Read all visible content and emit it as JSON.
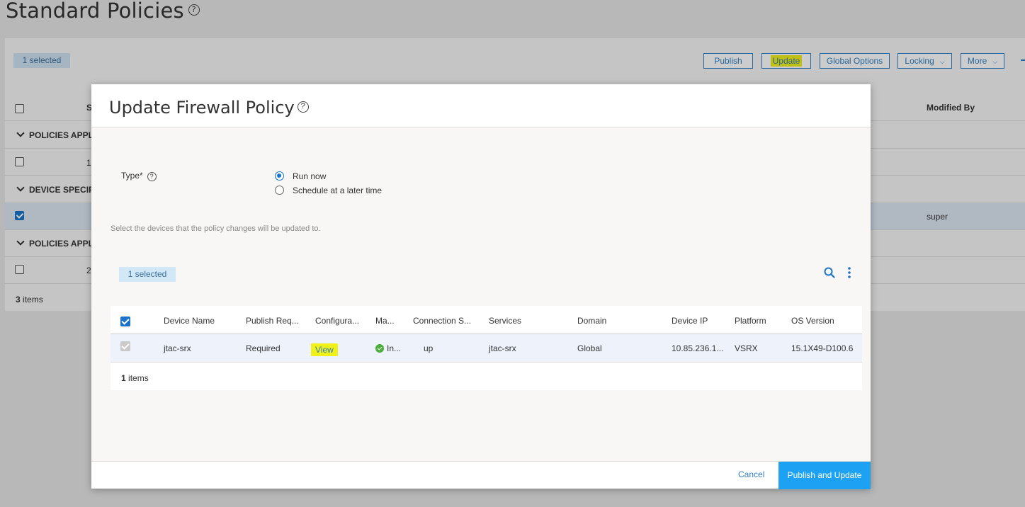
{
  "page": {
    "title": "Standard Policies",
    "help_glyph": "?"
  },
  "toolbar": {
    "selected_badge": "1 selected",
    "publish": "Publish",
    "update": "Update",
    "global_options": "Global Options",
    "locking": "Locking",
    "more": "More",
    "caret": "⌵"
  },
  "table": {
    "modified_by_header": "Modified By",
    "s_header_partial": "S",
    "groups": [
      {
        "label": "POLICIES APPLI"
      },
      {
        "label": "DEVICE SPECIFIC"
      },
      {
        "label": "POLICIES APPLI"
      }
    ],
    "rows": [
      {
        "seq_partial": "1",
        "modified_by": ""
      },
      {
        "seq_partial": "",
        "modified_by": "super"
      },
      {
        "seq_partial": "2",
        "modified_by": ""
      }
    ],
    "footer_count": "3",
    "footer_label": " items"
  },
  "modal": {
    "title": "Update Firewall Policy",
    "help_glyph": "?",
    "type_label": "Type*",
    "radio_options": [
      {
        "label": "Run now",
        "selected": true
      },
      {
        "label": "Schedule at a later time",
        "selected": false
      }
    ],
    "hint": "Select the devices that the policy changes will be updated to.",
    "selected_badge": "1 selected",
    "grid": {
      "headers": [
        "Device Name",
        "Publish Req...",
        "Configura...",
        "Ma...",
        "Connection S...",
        "Services",
        "Domain",
        "Device IP",
        "Platform",
        "OS Version"
      ],
      "row": {
        "device_name": "jtac-srx",
        "publish_required": "Required",
        "configuration": "View",
        "management_status": "In...",
        "connection_status": "up",
        "services": "jtac-srx",
        "domain": "Global",
        "device_ip": "10.85.236.1...",
        "platform": "VSRX",
        "os_version": "15.1X49-D100.6"
      },
      "footer_count": "1",
      "footer_label": " items"
    },
    "cancel": "Cancel",
    "primary": "Publish and Update"
  },
  "colors": {
    "accent": "#1a73c8",
    "primary_button": "#1da1f2",
    "highlight": "#f0f01a",
    "status_ok": "#4aae3b"
  }
}
